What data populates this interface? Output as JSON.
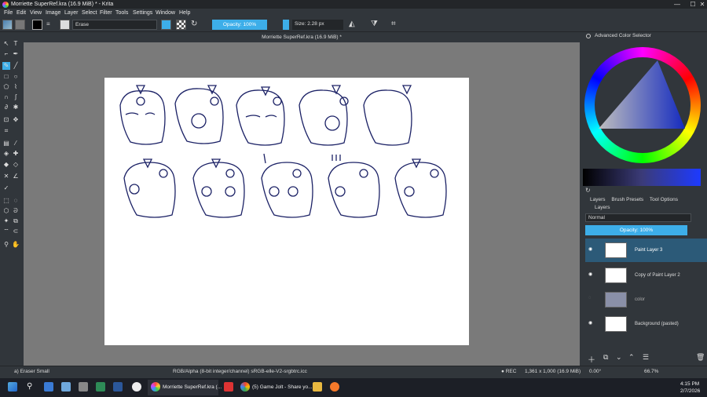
{
  "window": {
    "title": "Morriette SuperRef.kra (16.9 MiB) * - Krita",
    "min": "—",
    "max": "☐",
    "close": "✕"
  },
  "menu": [
    "File",
    "Edit",
    "View",
    "Image",
    "Layer",
    "Select",
    "Filter",
    "Tools",
    "Settings",
    "Window",
    "Help"
  ],
  "toolbar": {
    "preset": "Erase",
    "opacity": "Opacity: 100%",
    "size": "Size: 2.28 px"
  },
  "document": {
    "tab_title": "Morriette SuperRef.kra (16.9 MiB) *"
  },
  "color_selector": {
    "title": "Advanced Color Selector"
  },
  "layers_panel": {
    "tabs": [
      "Layers",
      "Brush Presets",
      "Tool Options"
    ],
    "header": "Layers",
    "blend_mode": "Normal",
    "opacity": "Opacity: 100%",
    "layers": [
      {
        "name": "Paint Layer 3",
        "selected": true
      },
      {
        "name": "Copy of Paint Layer 2",
        "selected": false
      },
      {
        "name": "color",
        "selected": false
      },
      {
        "name": "Background (pasted)",
        "selected": false
      }
    ]
  },
  "status": {
    "brush": "a) Eraser Small",
    "color_space": "RGB/Alpha (8-bit integer/channel)  sRGB-elle-V2-srgbtrc.icc",
    "rec": "● REC",
    "dims": "1,361 x 1,000 (16.9 MiB)",
    "rotation": "0.00°",
    "zoom": "66.7%"
  },
  "taskbar": {
    "app1": "Morriette SuperRef.kra (...",
    "app2": "(5) Game Jolt - Share yo...",
    "time": "4:15 PM",
    "date": "2/7/2026"
  }
}
